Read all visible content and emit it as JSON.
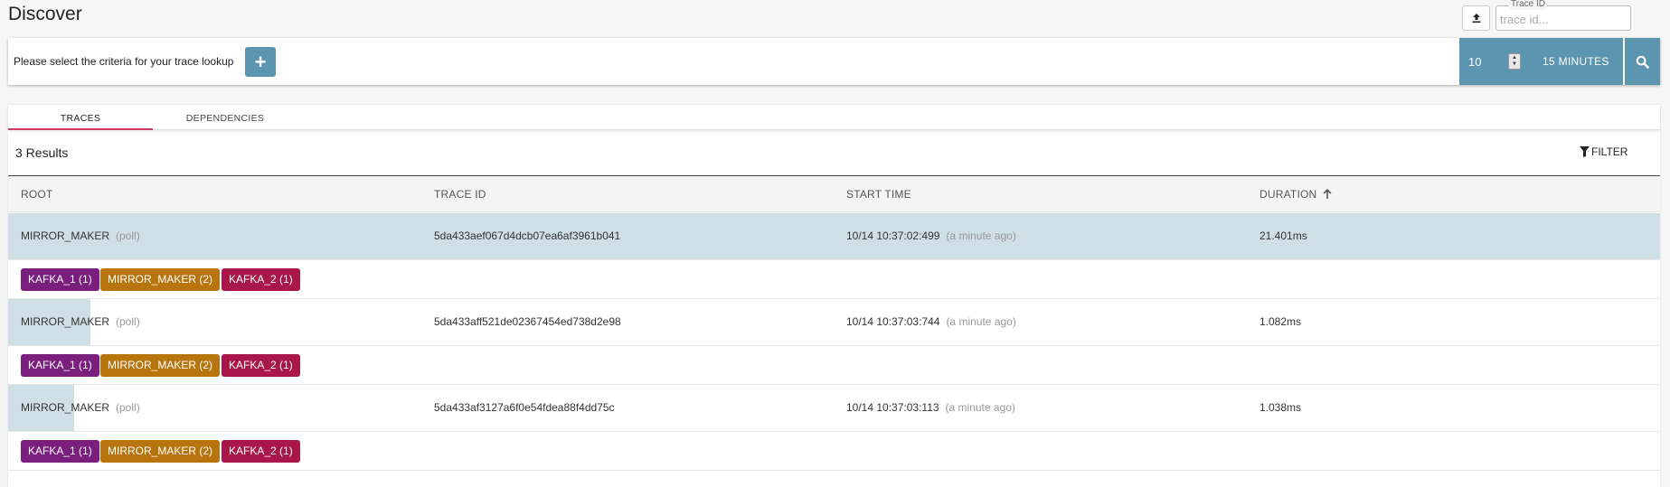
{
  "app": {
    "title": "Discover"
  },
  "trace_lookup": {
    "label": "Trace ID",
    "placeholder": "trace id...",
    "upload_icon": "upload-icon"
  },
  "criteria": {
    "prompt": "Please select the criteria for your trace lookup",
    "add_label": "+"
  },
  "controls": {
    "limit": "10",
    "lookback": "15 MINUTES",
    "search_icon": "search-icon"
  },
  "tabs": [
    {
      "label": "TRACES",
      "active": true
    },
    {
      "label": "DEPENDENCIES",
      "active": false
    }
  ],
  "results": {
    "count_label": "3 Results",
    "filter_label": "FILTER"
  },
  "table": {
    "headers": {
      "root": "ROOT",
      "trace_id": "TRACE ID",
      "start_time": "START TIME",
      "duration": "DURATION",
      "sort_icon": "arrow-up-icon"
    },
    "rows": [
      {
        "root": "MIRROR_MAKER",
        "operation": "(poll)",
        "trace_id": "5da433aef067d4dcb07ea6af3961b041",
        "start_time": "10/14 10:37:02:499",
        "relative_time": "(a minute ago)",
        "duration": "21.401ms",
        "duration_fraction": 1.0,
        "services": [
          {
            "label": "KAFKA_1 (1)",
            "color": "#7b1f7e"
          },
          {
            "label": "MIRROR_MAKER (2)",
            "color": "#b8740d"
          },
          {
            "label": "KAFKA_2 (1)",
            "color": "#a9174a"
          }
        ]
      },
      {
        "root": "MIRROR_MAKER",
        "operation": "(poll)",
        "trace_id": "5da433aff521de02367454ed738d2e98",
        "start_time": "10/14 10:37:03:744",
        "relative_time": "(a minute ago)",
        "duration": "1.082ms",
        "duration_fraction": 0.05,
        "services": [
          {
            "label": "KAFKA_1 (1)",
            "color": "#7b1f7e"
          },
          {
            "label": "MIRROR_MAKER (2)",
            "color": "#b8740d"
          },
          {
            "label": "KAFKA_2 (1)",
            "color": "#a9174a"
          }
        ]
      },
      {
        "root": "MIRROR_MAKER",
        "operation": "(poll)",
        "trace_id": "5da433af3127a6f0e54fdea88f4dd75c",
        "start_time": "10/14 10:37:03:113",
        "relative_time": "(a minute ago)",
        "duration": "1.038ms",
        "duration_fraction": 0.04,
        "services": [
          {
            "label": "KAFKA_1 (1)",
            "color": "#7b1f7e"
          },
          {
            "label": "MIRROR_MAKER (2)",
            "color": "#b8740d"
          },
          {
            "label": "KAFKA_2 (1)",
            "color": "#a9174a"
          }
        ]
      }
    ]
  },
  "colors": {
    "accent": "#5b95b0",
    "tab_underline": "#d23b63",
    "row_highlight": "#cfdfe6"
  }
}
